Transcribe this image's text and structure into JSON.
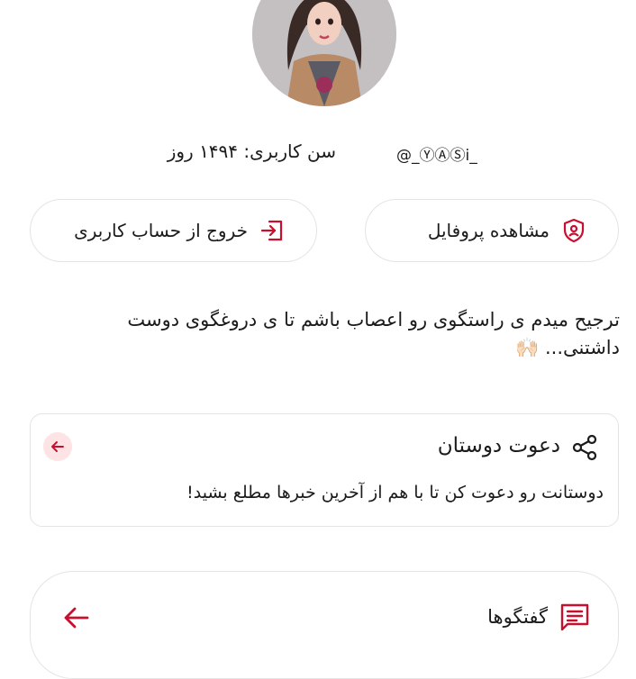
{
  "profile": {
    "age_text": "سن کاربری: ۱۴۹۴ روز",
    "username": "@_ⓎⒶⓈі̇_"
  },
  "buttons": {
    "view_profile": "مشاهده پروفایل",
    "logout": "خروج از حساب کاربری"
  },
  "bio": "ترجیح میدم ی راستگوی رو اعصاب باشم تا ی دروغگوی دوست داشتنی... 🙌🏻",
  "invite": {
    "title": "دعوت دوستان",
    "description": "دوستانت رو دعوت کن تا با هم از آخرین خبرها مطلع بشید!"
  },
  "chats": {
    "label": "گفتگوها"
  },
  "colors": {
    "accent": "#c8102e",
    "border": "#e4e4e4",
    "badge_bg": "#fde3e3"
  },
  "icons": [
    "shield-user-icon",
    "logout-icon",
    "share-icon",
    "arrow-left-icon",
    "chat-lines-icon"
  ]
}
